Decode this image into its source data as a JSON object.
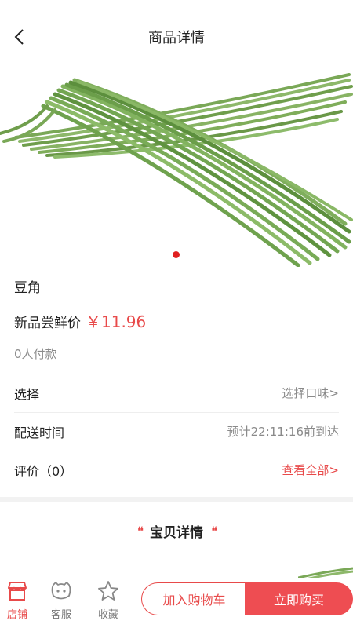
{
  "header": {
    "title": "商品详情",
    "back_icon": "chevron-left-icon"
  },
  "product": {
    "name": "豆角",
    "price_label": "新品尝鲜价",
    "price": "￥11.96",
    "paid_count": "0人付款",
    "carousel": {
      "total": 1,
      "active": 1
    }
  },
  "options": [
    {
      "label": "选择",
      "value": "选择口味>"
    },
    {
      "label": "配送时间",
      "value": "预计22:11:16前到达"
    },
    {
      "label": "评价（0）",
      "value": "查看全部>"
    }
  ],
  "detail": {
    "title": "宝贝详情"
  },
  "bottom_nav": [
    {
      "label": "店铺",
      "icon": "shop-icon"
    },
    {
      "label": "客服",
      "icon": "customer-service-icon"
    },
    {
      "label": "收藏",
      "icon": "star-icon"
    }
  ],
  "actions": {
    "add_to_cart": "加入购物车",
    "buy_now": "立即购买"
  },
  "colors": {
    "accent": "#e84a4a",
    "buy_button": "#ee4d52",
    "muted_text": "#8a8a8a"
  }
}
